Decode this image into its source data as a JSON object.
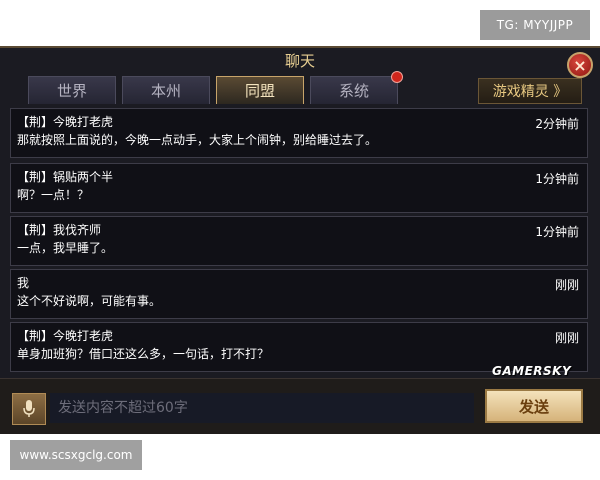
{
  "watermarks": {
    "top": "TG: MYYJJPP",
    "bottom": "www.scsxgclg.com",
    "gamersky": "GAMERSKY"
  },
  "chat": {
    "title": "聊天",
    "close": "×",
    "tabs": [
      {
        "label": "世界",
        "active": false
      },
      {
        "label": "本州",
        "active": false
      },
      {
        "label": "同盟",
        "active": true
      },
      {
        "label": "系统",
        "active": false,
        "has_notification": true
      }
    ],
    "elf_button": "游戏精灵 》",
    "messages": [
      {
        "sender": "【荆】今晚打老虎",
        "text": "那就按照上面说的，今晚一点动手，大家上个闹钟，别给睡过去了。",
        "time": "2分钟前"
      },
      {
        "sender": "【荆】锅贴两个半",
        "text": "啊？一点！？",
        "time": "1分钟前"
      },
      {
        "sender": "【荆】我伐齐师",
        "text": "一点，我早睡了。",
        "time": "1分钟前"
      },
      {
        "sender": "我",
        "text": "这个不好说啊，可能有事。",
        "time": "刚刚"
      },
      {
        "sender": "【荆】今晚打老虎",
        "text": "单身加班狗？借口还这么多，一句话，打不打？",
        "time": "刚刚"
      }
    ],
    "input": {
      "placeholder": "发送内容不超过60字",
      "value": ""
    },
    "send_label": "发送",
    "colors": {
      "accent_gold": "#e8cf92",
      "panel_bg": "#1b1b22",
      "notification_red": "#d0261c"
    }
  }
}
